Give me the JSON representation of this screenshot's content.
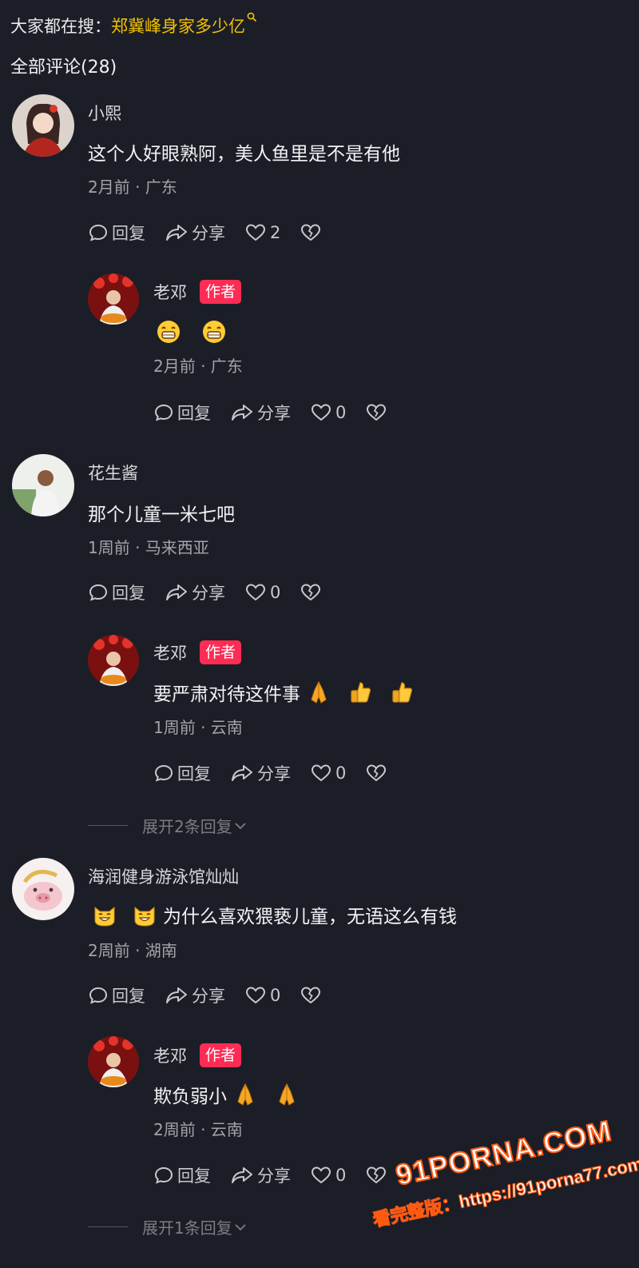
{
  "header": {
    "search_prefix": "大家都在搜：",
    "search_term": "郑冀峰身家多少亿",
    "search_icon": "search-icon",
    "all_comments": "全部评论(28)"
  },
  "actions": {
    "reply": "回复",
    "share": "分享"
  },
  "comments": [
    {
      "name": "小熙",
      "text": "这个人好眼熟阿，美人鱼里是不是有他",
      "meta": "2月前 · 广东",
      "likes": "2",
      "reply": {
        "name": "老邓",
        "badge": "作者",
        "text": "",
        "emoji_note": "grin-emoji x2",
        "meta": "2月前 · 广东",
        "likes": "0"
      }
    },
    {
      "name": "花生酱",
      "text": "那个儿童一米七吧",
      "meta": "1周前 · 马来西亚",
      "likes": "0",
      "reply": {
        "name": "老邓",
        "badge": "作者",
        "text": "要严肃对待这件事",
        "meta": "1周前 · 云南",
        "likes": "0"
      },
      "expand": "展开2条回复"
    },
    {
      "name": "海润健身游泳馆灿灿",
      "text": "为什么喜欢猥亵儿童，无语这么有钱",
      "meta": "2周前 · 湖南",
      "likes": "0",
      "reply": {
        "name": "老邓",
        "badge": "作者",
        "text": "欺负弱小",
        "meta": "2周前 · 云南",
        "likes": "0"
      },
      "expand": "展开1条回复"
    }
  ],
  "watermark": {
    "brand": "91PORNA.COM",
    "url": "看完整版：https://91porna77.com"
  },
  "colors": {
    "background": "#1c1e27",
    "search_term": "#f2c200",
    "author_badge": "#fe2c55"
  }
}
